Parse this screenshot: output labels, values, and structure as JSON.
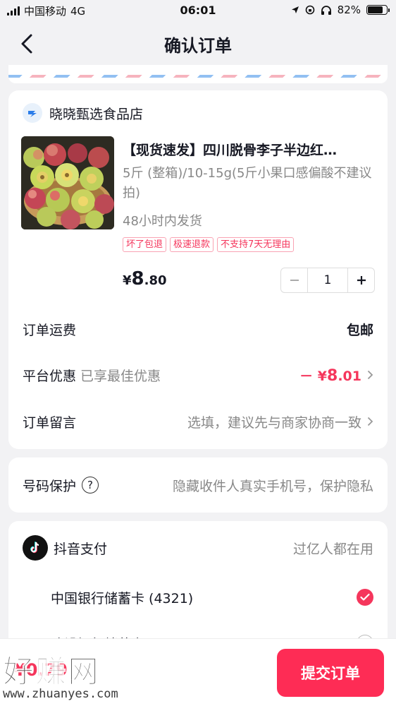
{
  "status_bar": {
    "carrier": "中国移动",
    "network": "4G",
    "time": "06:01",
    "battery": "82%",
    "battery_level": 0.82
  },
  "nav": {
    "title": "确认订单"
  },
  "shop": {
    "name": "晓晓甄选食品店"
  },
  "product": {
    "title": "【现货速发】四川脱骨李子半边红…",
    "spec": "5斤 (整箱)/10-15g(5斤小果口感偏酸不建议拍)",
    "shipping": "48小时内发货",
    "tags": [
      "坏了包退",
      "极速退款",
      "不支持7天无理由"
    ],
    "price": {
      "symbol": "¥",
      "integer": "8",
      "decimal": ".80"
    },
    "quantity": "1"
  },
  "rows": {
    "freight": {
      "label": "订单运费",
      "value": "包邮"
    },
    "discount": {
      "label": "平台优惠",
      "sub": "已享最佳优惠",
      "prefix": "－ ¥",
      "integer": "8",
      "decimal": ".01"
    },
    "note": {
      "label": "订单留言",
      "placeholder": "选填，建议先与商家协商一致"
    }
  },
  "privacy": {
    "label": "号码保护",
    "help": "?",
    "desc": "隐藏收件人真实手机号，保护隐私"
  },
  "payment": {
    "title": "抖音支付",
    "slogan": "过亿人都在用",
    "options": [
      {
        "label": "中国银行储蓄卡 (4321)",
        "selected": true
      },
      {
        "label": "建设银行储蓄卡 (…)",
        "selected": false
      }
    ]
  },
  "bottom": {
    "total": "¥0.79",
    "submit_label": "提交订单"
  },
  "watermark": {
    "text": "好赚网",
    "url": "www.zhuanyes.com"
  },
  "colors": {
    "accent": "#fe2c55",
    "discount": "#f5365c",
    "background": "#f2f2f4"
  },
  "icons": [
    "back-arrow-icon",
    "shop-logo-icon",
    "chevron-right-icon",
    "help-icon",
    "douyin-logo-icon",
    "check-icon",
    "radio-icon"
  ]
}
